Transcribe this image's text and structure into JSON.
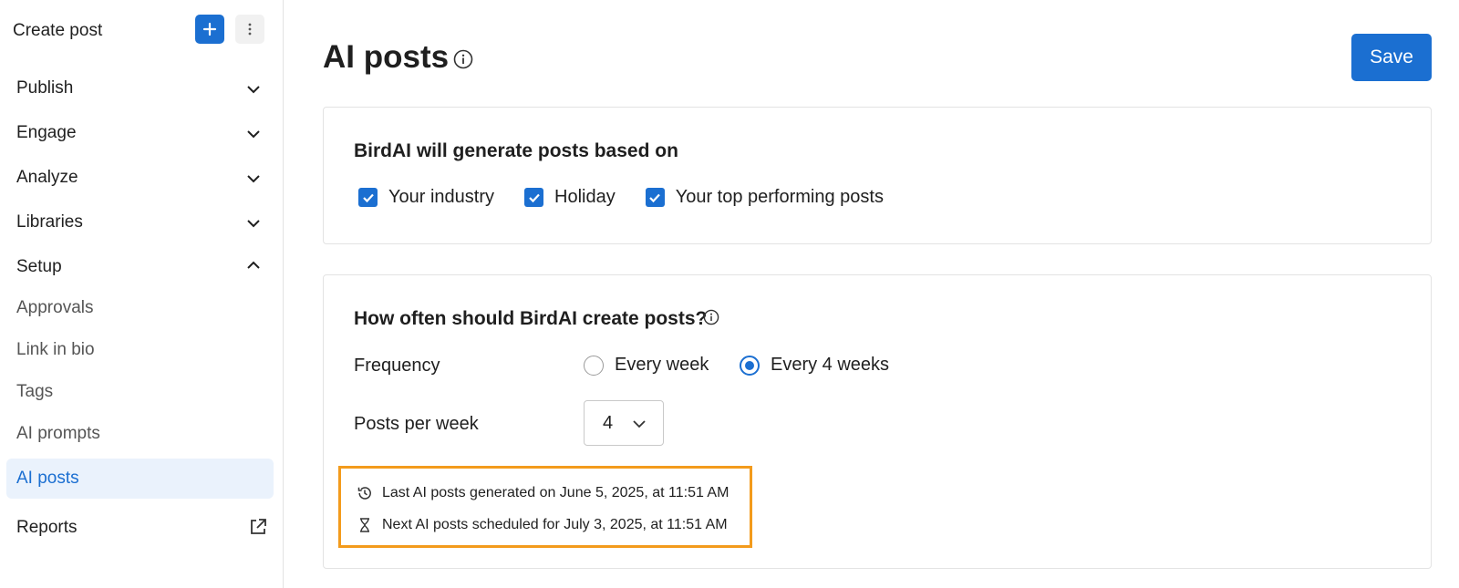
{
  "sidebar": {
    "create_post_label": "Create post",
    "groups": [
      {
        "label": "Publish",
        "expanded": false
      },
      {
        "label": "Engage",
        "expanded": false
      },
      {
        "label": "Analyze",
        "expanded": false
      },
      {
        "label": "Libraries",
        "expanded": false
      },
      {
        "label": "Setup",
        "expanded": true
      }
    ],
    "setup_items": [
      "Approvals",
      "Link in bio",
      "Tags",
      "AI prompts",
      "AI posts"
    ],
    "active_item": "AI posts",
    "reports_label": "Reports"
  },
  "header": {
    "title": "AI posts",
    "save_label": "Save"
  },
  "generation_card": {
    "heading": "BirdAI will generate posts based on",
    "checkboxes": [
      {
        "label": "Your industry",
        "checked": true
      },
      {
        "label": "Holiday",
        "checked": true
      },
      {
        "label": "Your top performing posts",
        "checked": true
      }
    ]
  },
  "frequency_card": {
    "heading": "How often should BirdAI create posts?",
    "frequency_label": "Frequency",
    "options": [
      {
        "label": "Every week",
        "selected": false
      },
      {
        "label": "Every 4 weeks",
        "selected": true
      }
    ],
    "posts_per_week_label": "Posts per week",
    "posts_per_week_value": "4",
    "last_generated": "Last AI posts generated on June 5, 2025, at 11:51 AM",
    "next_scheduled": "Next AI posts scheduled for July 3, 2025, at 11:51 AM"
  },
  "colors": {
    "accent": "#1b6fd1",
    "highlight_border": "#f39b1c",
    "active_bg": "#eaf2fc"
  },
  "icons": [
    "plus-icon",
    "more-vertical-icon",
    "chevron-down-icon",
    "chevron-up-icon",
    "external-link-icon",
    "info-icon",
    "check-icon",
    "history-icon",
    "hourglass-icon"
  ]
}
